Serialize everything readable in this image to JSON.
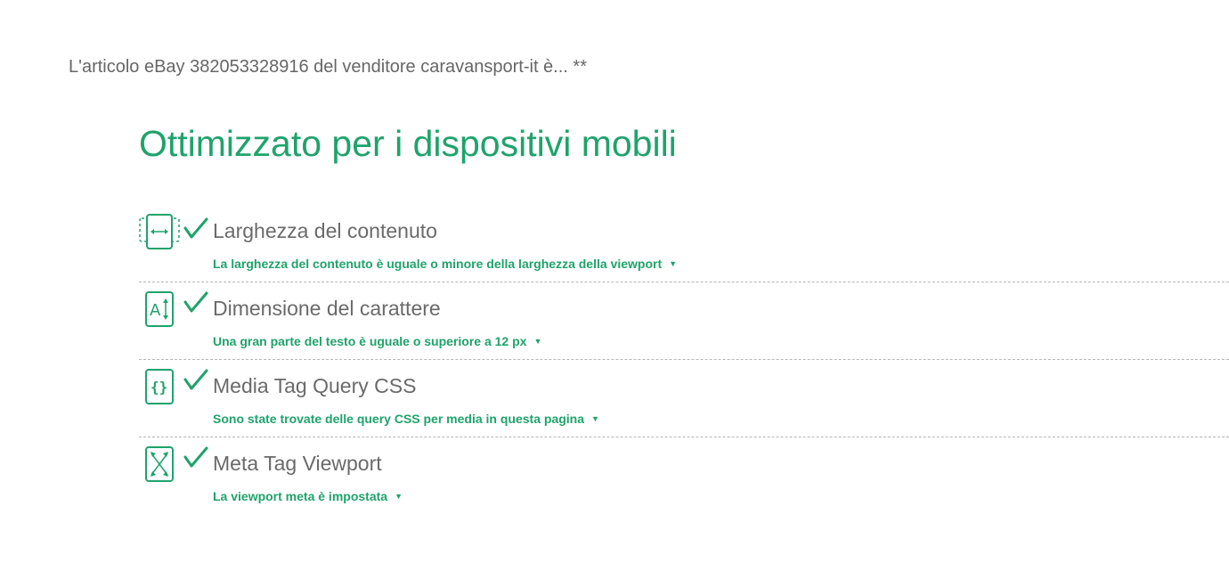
{
  "header": {
    "title": "L'articolo eBay 382053328916 del venditore caravansport-it è... **"
  },
  "section": {
    "heading": "Ottimizzato per i dispositivi mobili"
  },
  "checks": [
    {
      "icon": "content-width-icon",
      "status": "pass",
      "title": "Larghezza del contenuto",
      "description": "La larghezza del contenuto è uguale o minore della larghezza della viewport"
    },
    {
      "icon": "font-size-icon",
      "status": "pass",
      "title": "Dimensione del carattere",
      "description": "Una gran parte del testo è uguale o superiore a 12 px"
    },
    {
      "icon": "css-braces-icon",
      "status": "pass",
      "title": "Media Tag Query CSS",
      "description": "Sono state trovate delle query CSS per media in questa pagina"
    },
    {
      "icon": "viewport-expand-icon",
      "status": "pass",
      "title": "Meta Tag Viewport",
      "description": "La viewport meta è impostata"
    }
  ],
  "colors": {
    "accent": "#1fa36b",
    "text_gray": "#666666",
    "divider": "#b5b5b5"
  }
}
